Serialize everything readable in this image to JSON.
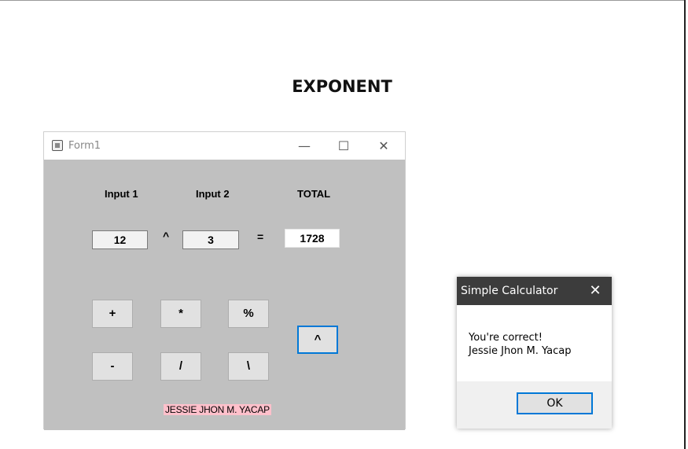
{
  "document": {
    "heading": "EXPONENT"
  },
  "form": {
    "title": "Form1",
    "input1": {
      "label": "Input 1",
      "value": "12"
    },
    "input2": {
      "label": "Input 2",
      "value": "3"
    },
    "operator_symbol": "^",
    "equals_symbol": "=",
    "total": {
      "label": "TOTAL",
      "value": "1728"
    },
    "buttons": {
      "add": "+",
      "multiply": "*",
      "modulo": "%",
      "subtract": "-",
      "divide": "/",
      "int_divide": "\\",
      "power": "^"
    },
    "author_label": "JESSIE JHON M. YACAP"
  },
  "message_box": {
    "title": "Simple Calculator",
    "line1": "You're correct!",
    "line2": "Jessie Jhon M. Yacap",
    "ok_label": "OK"
  },
  "icons": {
    "minimize": "minimize-icon",
    "maximize": "maximize-icon",
    "close": "close-icon",
    "app": "form-app-icon"
  },
  "colors": {
    "form_background": "#c0c0c0",
    "author_label_background": "#ffc0cb",
    "focus_border": "#0078d7",
    "msg_titlebar": "#3c3c3c"
  }
}
